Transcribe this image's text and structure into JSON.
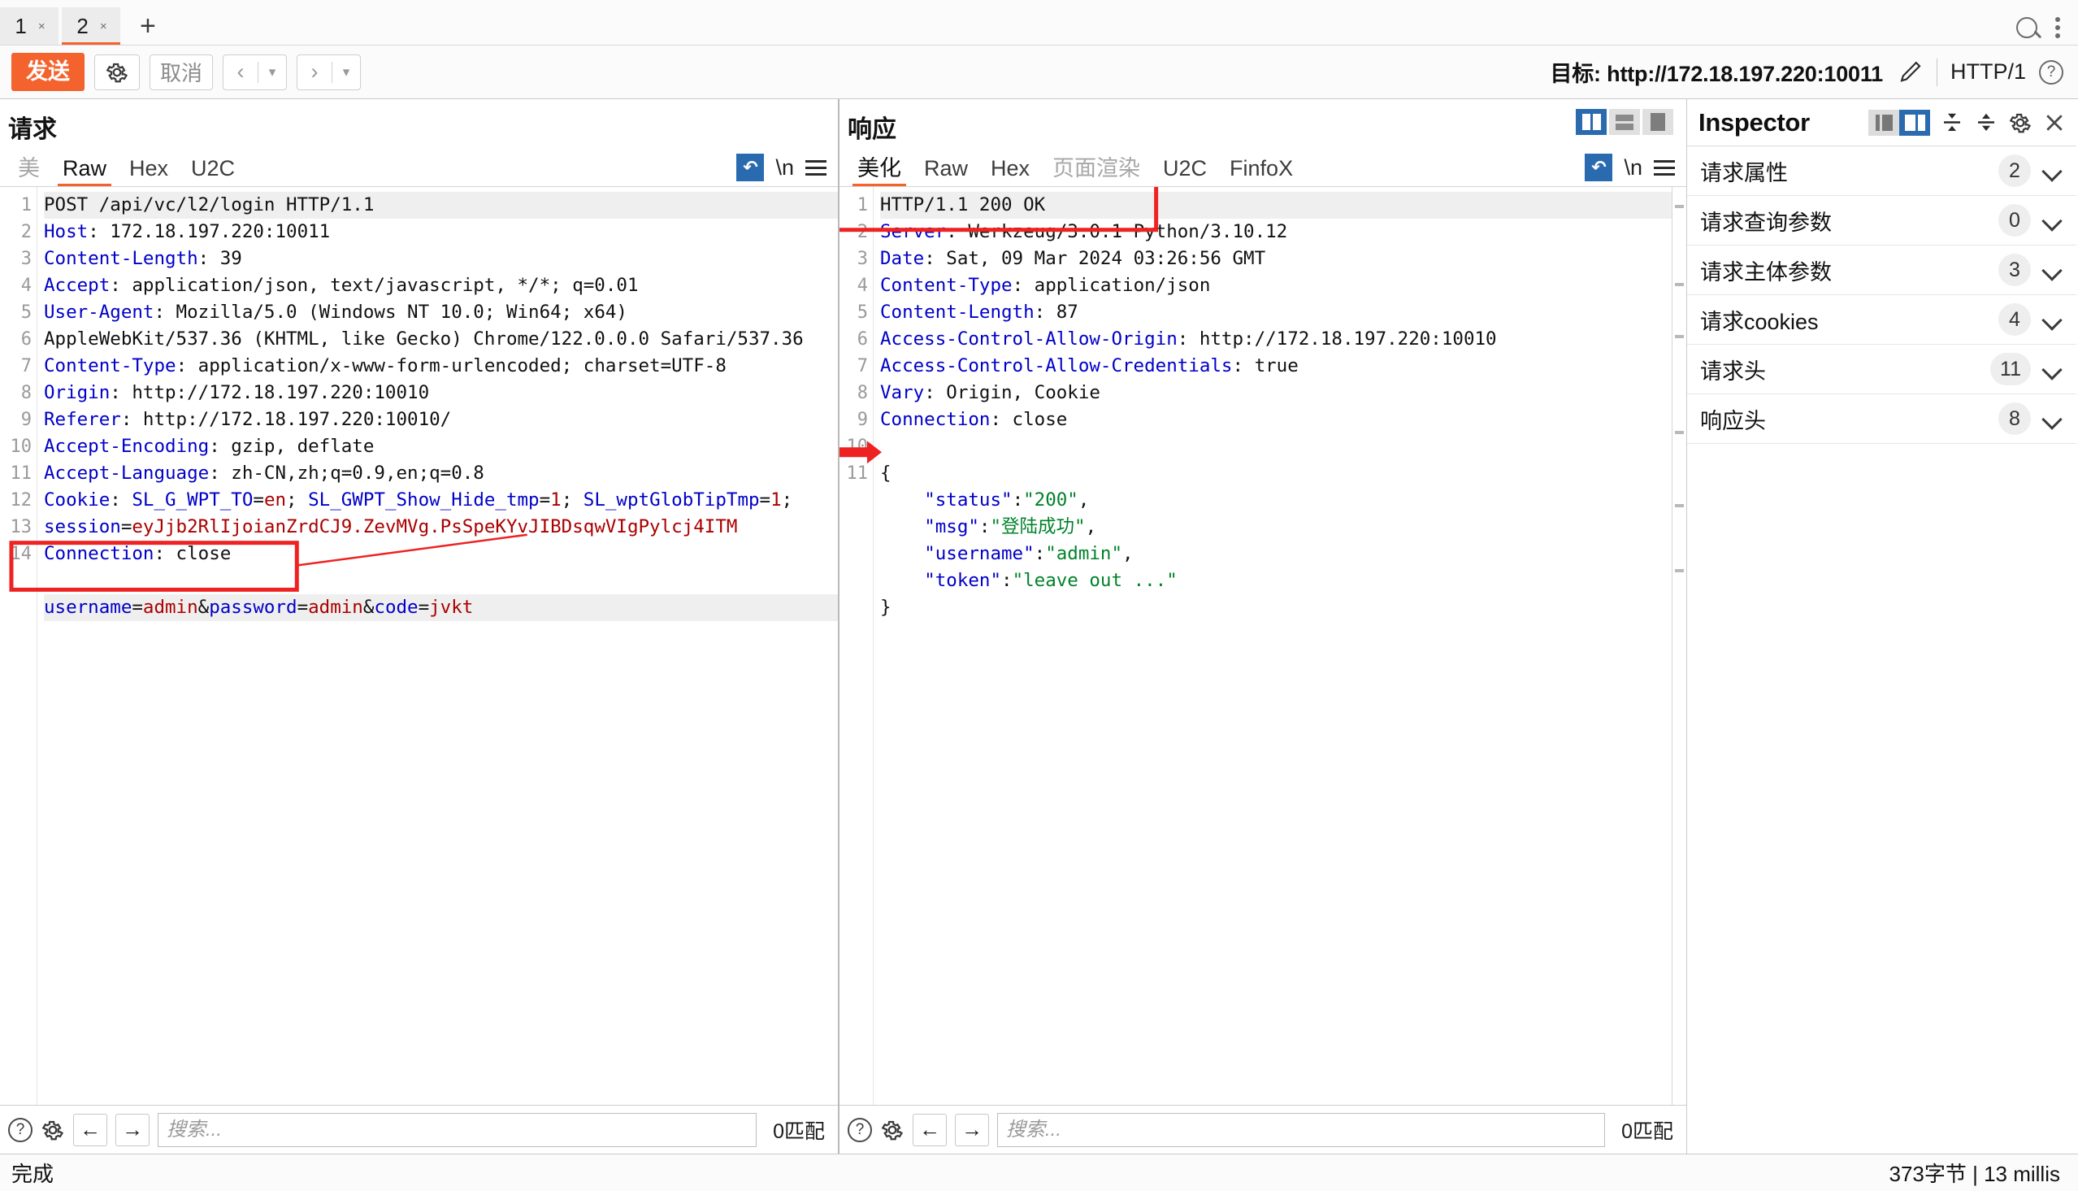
{
  "tabbar": {
    "tabs": [
      {
        "label": "1",
        "close": "×",
        "active": false
      },
      {
        "label": "2",
        "close": "×",
        "active": true
      }
    ],
    "add_label": "+",
    "search_icon": "search-icon",
    "menu_icon": "kebab-menu-icon"
  },
  "toolbar": {
    "send_label": "发送",
    "settings_icon": "gear-icon",
    "cancel_label": "取消",
    "prev_label": "‹",
    "prev_caret": "▾",
    "next_label": "›",
    "next_caret": "▾",
    "target_label": "目标: http://172.18.197.220:10011",
    "edit_icon": "pencil-icon",
    "http_version": "HTTP/1",
    "help_icon": "help-circle-icon"
  },
  "request": {
    "title": "请求",
    "tabs": [
      {
        "label": "美",
        "state": "muted"
      },
      {
        "label": "Raw",
        "state": "active"
      },
      {
        "label": "Hex",
        "state": "normal"
      },
      {
        "label": "U2C",
        "state": "normal"
      }
    ],
    "wrap_icon": "word-wrap-icon",
    "newline_label": "\\n",
    "menu_icon": "hamburger-menu-icon",
    "lines": [
      {
        "n": "1",
        "highlight": true,
        "parts": [
          {
            "t": "POST /api/vc/l2/login HTTP/1.1",
            "c": "v"
          }
        ]
      },
      {
        "n": "2",
        "parts": [
          {
            "t": "Host",
            "c": "k"
          },
          {
            "t": ": 172.18.197.220:10011",
            "c": "v"
          }
        ]
      },
      {
        "n": "3",
        "parts": [
          {
            "t": "Content-Length",
            "c": "k"
          },
          {
            "t": ": 39",
            "c": "v"
          }
        ]
      },
      {
        "n": "4",
        "parts": [
          {
            "t": "Accept",
            "c": "k"
          },
          {
            "t": ": application/json, text/javascript, */*; q=0.01",
            "c": "v"
          }
        ]
      },
      {
        "n": "5",
        "parts": [
          {
            "t": "User-Agent",
            "c": "k"
          },
          {
            "t": ": Mozilla/5.0 (Windows NT 10.0; Win64; x64)",
            "c": "v"
          }
        ]
      },
      {
        "n": "",
        "parts": [
          {
            "t": "AppleWebKit/537.36 (KHTML, like Gecko) Chrome/122.0.0.0 Safari/537.36",
            "c": "v"
          }
        ]
      },
      {
        "n": "6",
        "parts": [
          {
            "t": "Content-Type",
            "c": "k"
          },
          {
            "t": ": application/x-www-form-urlencoded; charset=UTF-8",
            "c": "v"
          }
        ]
      },
      {
        "n": "7",
        "parts": [
          {
            "t": "Origin",
            "c": "k"
          },
          {
            "t": ": http://172.18.197.220:10010",
            "c": "v"
          }
        ]
      },
      {
        "n": "8",
        "parts": [
          {
            "t": "Referer",
            "c": "k"
          },
          {
            "t": ": http://172.18.197.220:10010/",
            "c": "v"
          }
        ]
      },
      {
        "n": "9",
        "parts": [
          {
            "t": "Accept-Encoding",
            "c": "k"
          },
          {
            "t": ": gzip, deflate",
            "c": "v"
          }
        ]
      },
      {
        "n": "10",
        "parts": [
          {
            "t": "Accept-Language",
            "c": "k"
          },
          {
            "t": ": zh-CN,zh;q=0.9,en;q=0.8",
            "c": "v"
          }
        ]
      },
      {
        "n": "11",
        "parts": [
          {
            "t": "Cookie",
            "c": "k"
          },
          {
            "t": ": ",
            "c": "v"
          },
          {
            "t": "SL_G_WPT_TO",
            "c": "b"
          },
          {
            "t": "=",
            "c": "v"
          },
          {
            "t": "en",
            "c": "r"
          },
          {
            "t": "; ",
            "c": "v"
          },
          {
            "t": "SL_GWPT_Show_Hide_tmp",
            "c": "b"
          },
          {
            "t": "=",
            "c": "v"
          },
          {
            "t": "1",
            "c": "r"
          },
          {
            "t": "; ",
            "c": "v"
          },
          {
            "t": "SL_wptGlobTipTmp",
            "c": "b"
          },
          {
            "t": "=",
            "c": "v"
          },
          {
            "t": "1",
            "c": "r"
          },
          {
            "t": ";",
            "c": "v"
          }
        ]
      },
      {
        "n": "",
        "parts": [
          {
            "t": "session",
            "c": "b"
          },
          {
            "t": "=",
            "c": "v"
          },
          {
            "t": "eyJjb2RlIjoianZrdCJ9.ZevMVg.PsSpeKYvJIBDsqwVIgPylcj4ITM",
            "c": "r"
          }
        ]
      },
      {
        "n": "12",
        "parts": [
          {
            "t": "Connection",
            "c": "k"
          },
          {
            "t": ": close",
            "c": "v"
          }
        ]
      },
      {
        "n": "13",
        "parts": [
          {
            "t": "",
            "c": "v"
          }
        ]
      },
      {
        "n": "14",
        "highlight": true,
        "parts": [
          {
            "t": "username",
            "c": "b"
          },
          {
            "t": "=",
            "c": "v"
          },
          {
            "t": "admin",
            "c": "r"
          },
          {
            "t": "&",
            "c": "v"
          },
          {
            "t": "password",
            "c": "b"
          },
          {
            "t": "=",
            "c": "v"
          },
          {
            "t": "admin",
            "c": "r"
          },
          {
            "t": "&",
            "c": "v"
          },
          {
            "t": "code",
            "c": "b"
          },
          {
            "t": "=",
            "c": "v"
          },
          {
            "t": "jvkt",
            "c": "r"
          }
        ]
      }
    ],
    "find": {
      "help_icon": "help-circle-icon",
      "settings_icon": "gear-icon",
      "prev_icon": "arrow-left-icon",
      "next_icon": "arrow-right-icon",
      "placeholder": "搜索...",
      "value": "",
      "match_count": "0匹配"
    }
  },
  "response": {
    "title": "响应",
    "layout_buttons": [
      "split-vertical-icon",
      "split-horizontal-icon",
      "single-pane-icon"
    ],
    "layout_active_index": 0,
    "tabs": [
      {
        "label": "美化",
        "state": "active"
      },
      {
        "label": "Raw",
        "state": "normal"
      },
      {
        "label": "Hex",
        "state": "normal"
      },
      {
        "label": "页面渲染",
        "state": "muted"
      },
      {
        "label": "U2C",
        "state": "normal"
      },
      {
        "label": "FinfoX",
        "state": "normal"
      }
    ],
    "wrap_icon": "word-wrap-icon",
    "newline_label": "\\n",
    "menu_icon": "hamburger-menu-icon",
    "lines": [
      {
        "n": "1",
        "highlight": true,
        "parts": [
          {
            "t": "HTTP/1.1 200 OK",
            "c": "v"
          }
        ]
      },
      {
        "n": "2",
        "parts": [
          {
            "t": "Server",
            "c": "k"
          },
          {
            "t": ": Werkzeug/3.0.1 Python/3.10.12",
            "c": "v"
          }
        ]
      },
      {
        "n": "3",
        "parts": [
          {
            "t": "Date",
            "c": "k"
          },
          {
            "t": ": Sat, 09 Mar 2024 03:26:56 GMT",
            "c": "v"
          }
        ]
      },
      {
        "n": "4",
        "parts": [
          {
            "t": "Content-Type",
            "c": "k"
          },
          {
            "t": ": application/json",
            "c": "v"
          }
        ]
      },
      {
        "n": "5",
        "parts": [
          {
            "t": "Content-Length",
            "c": "k"
          },
          {
            "t": ": 87",
            "c": "v"
          }
        ]
      },
      {
        "n": "6",
        "parts": [
          {
            "t": "Access-Control-Allow-Origin",
            "c": "k"
          },
          {
            "t": ": http://172.18.197.220:10010",
            "c": "v"
          }
        ]
      },
      {
        "n": "7",
        "parts": [
          {
            "t": "Access-Control-Allow-Credentials",
            "c": "k"
          },
          {
            "t": ": true",
            "c": "v"
          }
        ]
      },
      {
        "n": "8",
        "parts": [
          {
            "t": "Vary",
            "c": "k"
          },
          {
            "t": ": Origin, Cookie",
            "c": "v"
          }
        ]
      },
      {
        "n": "9",
        "parts": [
          {
            "t": "Connection",
            "c": "k"
          },
          {
            "t": ": close",
            "c": "v"
          }
        ]
      },
      {
        "n": "10",
        "parts": [
          {
            "t": "",
            "c": "v"
          }
        ]
      },
      {
        "n": "11",
        "parts": [
          {
            "t": "{",
            "c": "v"
          }
        ]
      },
      {
        "n": "",
        "parts": [
          {
            "t": "    ",
            "c": "v"
          },
          {
            "t": "\"status\"",
            "c": "b"
          },
          {
            "t": ":",
            "c": "v"
          },
          {
            "t": "\"200\"",
            "c": "g"
          },
          {
            "t": ",",
            "c": "v"
          }
        ]
      },
      {
        "n": "",
        "parts": [
          {
            "t": "    ",
            "c": "v"
          },
          {
            "t": "\"msg\"",
            "c": "b"
          },
          {
            "t": ":",
            "c": "v"
          },
          {
            "t": "\"登陆成功\"",
            "c": "g"
          },
          {
            "t": ",",
            "c": "v"
          }
        ]
      },
      {
        "n": "",
        "parts": [
          {
            "t": "    ",
            "c": "v"
          },
          {
            "t": "\"username\"",
            "c": "b"
          },
          {
            "t": ":",
            "c": "v"
          },
          {
            "t": "\"admin\"",
            "c": "g"
          },
          {
            "t": ",",
            "c": "v"
          }
        ]
      },
      {
        "n": "",
        "parts": [
          {
            "t": "    ",
            "c": "v"
          },
          {
            "t": "\"token\"",
            "c": "b"
          },
          {
            "t": ":",
            "c": "v"
          },
          {
            "t": "\"leave out ...\"",
            "c": "g"
          }
        ]
      },
      {
        "n": "",
        "parts": [
          {
            "t": "}",
            "c": "v"
          }
        ]
      }
    ],
    "find": {
      "help_icon": "help-circle-icon",
      "settings_icon": "gear-icon",
      "prev_icon": "arrow-left-icon",
      "next_icon": "arrow-right-icon",
      "placeholder": "搜索...",
      "value": "",
      "match_count": "0匹配"
    }
  },
  "inspector": {
    "title": "Inspector",
    "toggle_left_icon": "layout-left-icon",
    "toggle_right_icon": "layout-right-icon",
    "collapse_all_icon": "collapse-all-icon",
    "expand_all_icon": "expand-all-icon",
    "settings_icon": "gear-icon",
    "close_icon": "close-icon",
    "rows": [
      {
        "label": "请求属性",
        "count": "2"
      },
      {
        "label": "请求查询参数",
        "count": "0"
      },
      {
        "label": "请求主体参数",
        "count": "3"
      },
      {
        "label": "请求cookies",
        "count": "4"
      },
      {
        "label": "请求头",
        "count": "11"
      },
      {
        "label": "响应头",
        "count": "8"
      }
    ]
  },
  "statusbar": {
    "left": "完成",
    "right": "373字节 | 13 millis"
  },
  "colors": {
    "accent_orange": "#f4622e",
    "accent_blue": "#2a6bb0",
    "annotation_red": "#ee2222",
    "header_blue": "#0000c8",
    "value_red": "#aa0000",
    "string_green": "#00822a"
  }
}
